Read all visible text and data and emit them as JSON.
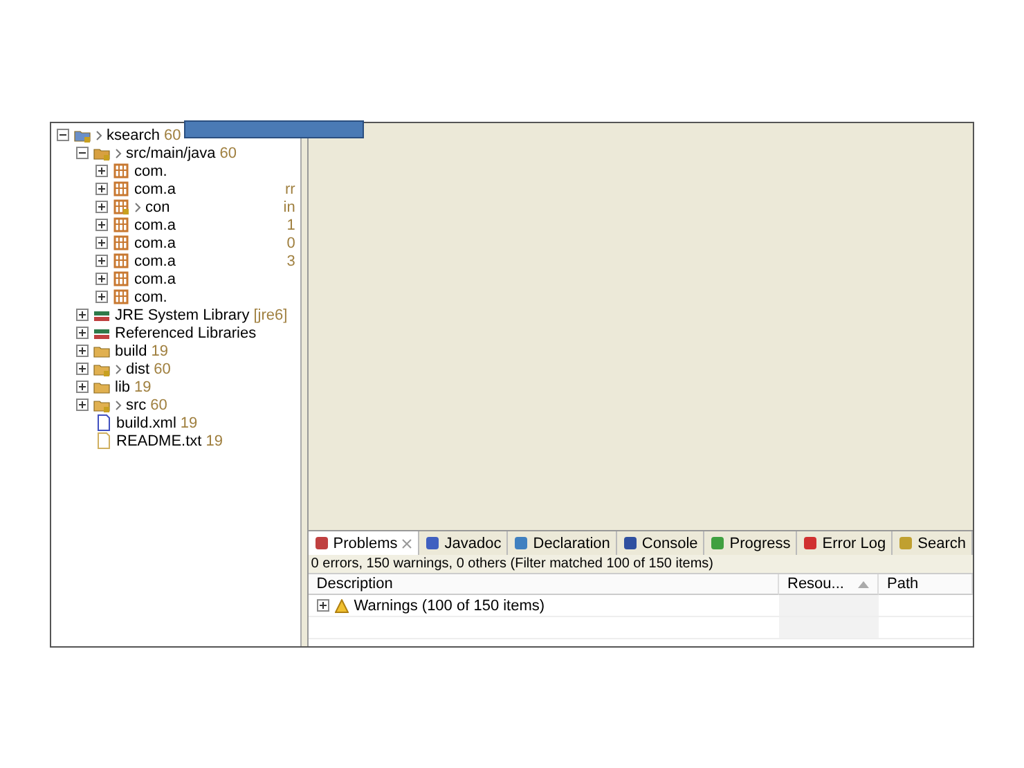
{
  "tree": [
    {
      "label": "ksearch",
      "decoration": "60",
      "kind": "project",
      "changed": true,
      "expanded": true,
      "children": [
        {
          "label": "src/main/java",
          "decoration": "60",
          "kind": "source-folder",
          "changed": true,
          "expanded": true,
          "children": [
            {
              "label": "com.",
              "kind": "package",
              "changed": false,
              "expanded": false
            },
            {
              "label": "com.a",
              "tail": "rr",
              "kind": "package",
              "changed": false,
              "expanded": false
            },
            {
              "label": "con",
              "tail": "in",
              "kind": "package",
              "changed": true,
              "expanded": false
            },
            {
              "label": "com.a",
              "tail": "1",
              "kind": "package",
              "changed": false,
              "expanded": false
            },
            {
              "label": "com.a",
              "tail": "0",
              "kind": "package",
              "changed": false,
              "expanded": false
            },
            {
              "label": "com.a",
              "tail": "3",
              "kind": "package",
              "changed": false,
              "expanded": false
            },
            {
              "label": "com.a",
              "kind": "package",
              "changed": false,
              "expanded": false
            },
            {
              "label": "com.",
              "kind": "package",
              "changed": false,
              "expanded": false
            }
          ]
        },
        {
          "label": "JRE System Library",
          "decoration": "[jre6]",
          "kind": "library",
          "changed": false,
          "expanded": false
        },
        {
          "label": "Referenced Libraries",
          "kind": "library",
          "changed": false,
          "expanded": false
        },
        {
          "label": "build",
          "decoration": "19",
          "kind": "folder",
          "changed": false,
          "expanded": false
        },
        {
          "label": "dist",
          "decoration": "60",
          "kind": "folder",
          "changed": true,
          "expanded": false
        },
        {
          "label": "lib",
          "decoration": "19",
          "kind": "folder",
          "changed": false,
          "expanded": false
        },
        {
          "label": "src",
          "decoration": "60",
          "kind": "folder",
          "changed": true,
          "expanded": false
        },
        {
          "label": "build.xml",
          "decoration": "19",
          "kind": "xml-file",
          "changed": false
        },
        {
          "label": "README.txt",
          "decoration": "19",
          "kind": "text-file",
          "changed": false
        }
      ]
    }
  ],
  "problems": {
    "tabs": [
      {
        "label": "Problems",
        "kind": "problems",
        "selected": true
      },
      {
        "label": "Javadoc",
        "kind": "javadoc",
        "selected": false
      },
      {
        "label": "Declaration",
        "kind": "declaration",
        "selected": false
      },
      {
        "label": "Console",
        "kind": "console",
        "selected": false
      },
      {
        "label": "Progress",
        "kind": "progress",
        "selected": false
      },
      {
        "label": "Error Log",
        "kind": "errorlog",
        "selected": false
      },
      {
        "label": "Search",
        "kind": "search",
        "selected": false
      }
    ],
    "summary": "0 errors, 150 warnings, 0 others (Filter matched 100 of 150 items)",
    "columns": [
      "Description",
      "Resou...",
      "Path"
    ],
    "rows": [
      {
        "label": "Warnings (100 of 150 items)",
        "expanded": false
      }
    ]
  }
}
